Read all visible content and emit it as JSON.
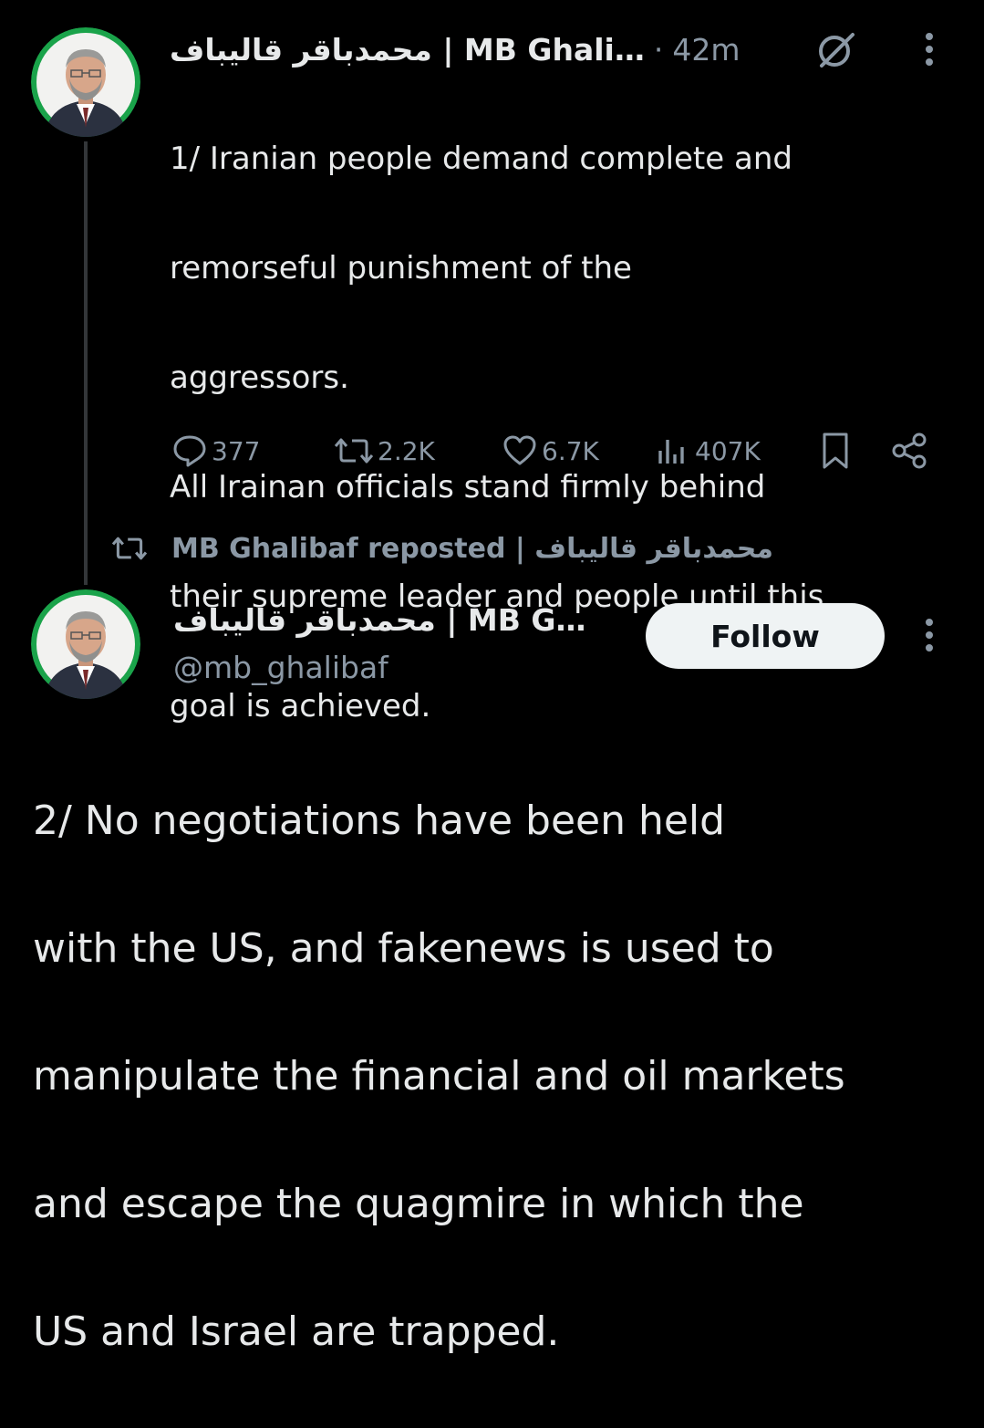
{
  "tweet1": {
    "display_name": "…MB Ghali | محمدباقر قالیباف",
    "separator": "·",
    "time": "42m",
    "text_lines": [
      "1/ Iranian people demand complete and",
      "remorseful punishment of the",
      "aggressors.",
      "All Irainan officials stand firmly behind",
      "their supreme leader and people until this",
      "goal is achieved."
    ],
    "stats": {
      "replies": "377",
      "reposts": "2.2K",
      "likes": "6.7K",
      "views": "407K"
    }
  },
  "repost_notice": {
    "text": "MB Ghalibaf reposted | محمدباقر قالیباف"
  },
  "tweet2": {
    "display_name": "…MB G | محمدباقر قالیباف",
    "handle": "@mb_ghalibaf",
    "follow_label": "Follow",
    "text_lines": [
      "2/ No negotiations have been held",
      "with the US, and fakenews is used to",
      "manipulate the financial and oil markets",
      "and escape the quagmire in which the",
      "US and Israel are trapped."
    ]
  },
  "icons": {
    "avatar": "avatar",
    "grok": "grok-icon",
    "more": "more-icon",
    "reply": "reply-icon",
    "repost": "repost-icon",
    "like": "heart-icon",
    "views": "views-icon",
    "bookmark": "bookmark-icon",
    "share": "share-icon"
  },
  "colors": {
    "background": "#000000",
    "text": "#e7e9ea",
    "muted": "#8b98a5",
    "avatar_ring": "#1aa34a",
    "follow_bg": "#eff3f4"
  }
}
